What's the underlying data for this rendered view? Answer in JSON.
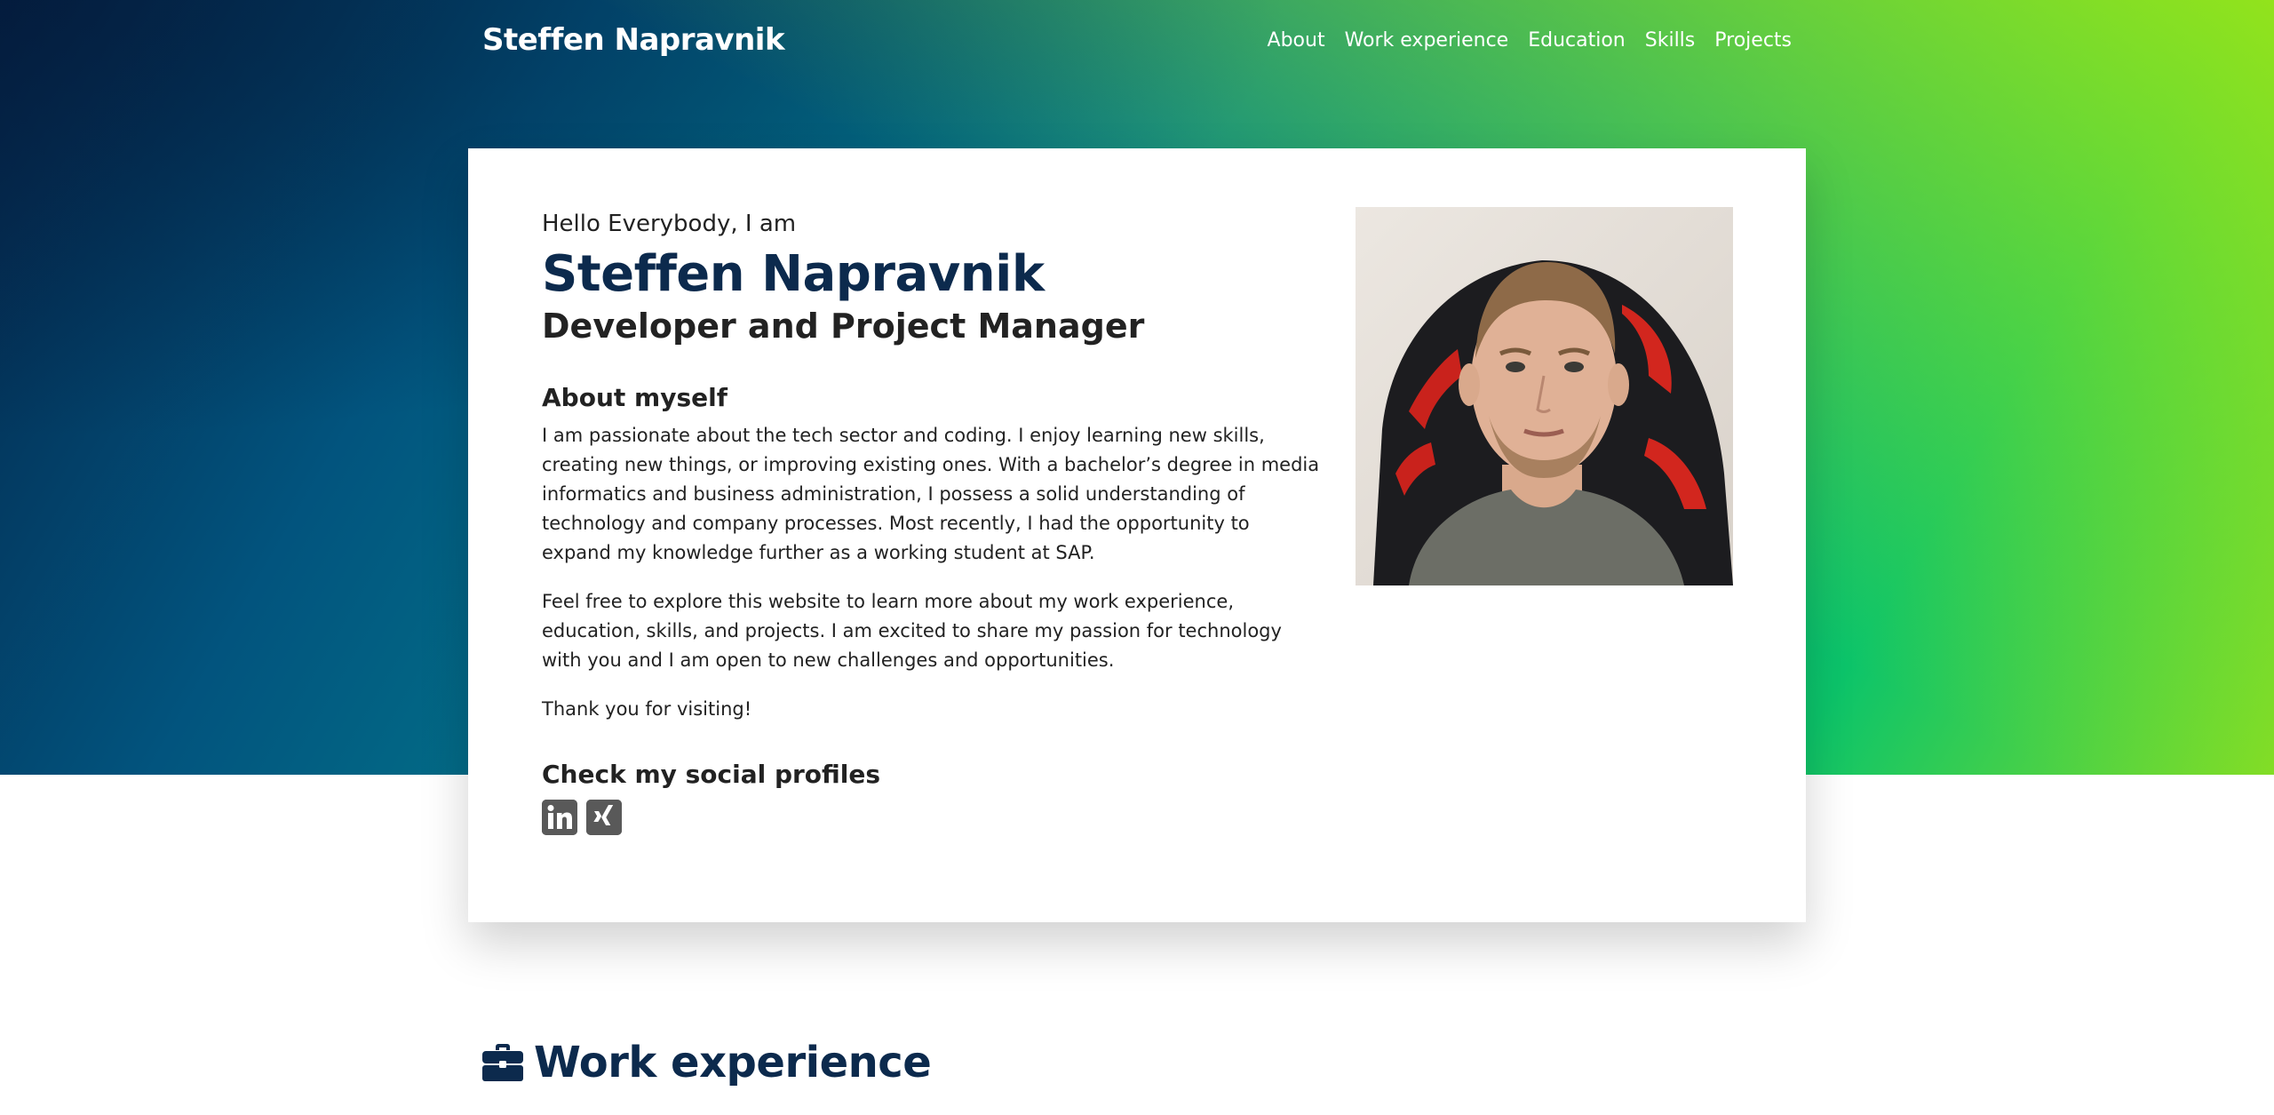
{
  "nav": {
    "brand": "Steffen Napravnik",
    "links": [
      "About",
      "Work experience",
      "Education",
      "Skills",
      "Projects"
    ]
  },
  "hero": {
    "greeting": "Hello Everybody, I am",
    "name": "Steffen Napravnik",
    "role": "Developer and Project Manager",
    "about_heading": "About myself",
    "about_paragraph_1": "I am passionate about the tech sector and coding. I enjoy learning new skills, creating new things, or improving existing ones. With a bachelor’s degree in media informatics and business administration, I possess a solid understanding of technology and company processes. Most recently, I had the opportunity to expand my knowledge further as a working student at SAP.",
    "about_paragraph_2": "Feel free to explore this website to learn more about my work experience, education, skills, and projects. I am excited to share my passion for technology with you and I am open to new challenges and opportunities.",
    "thanks": "Thank you for visiting!",
    "social_heading": "Check my social profiles",
    "social_icons": [
      "linkedin-icon",
      "xing-icon"
    ]
  },
  "work": {
    "heading": "Work experience",
    "icon": "briefcase-icon"
  },
  "colors": {
    "name_color": "#0c2a4d",
    "icon_gray": "#595959"
  }
}
